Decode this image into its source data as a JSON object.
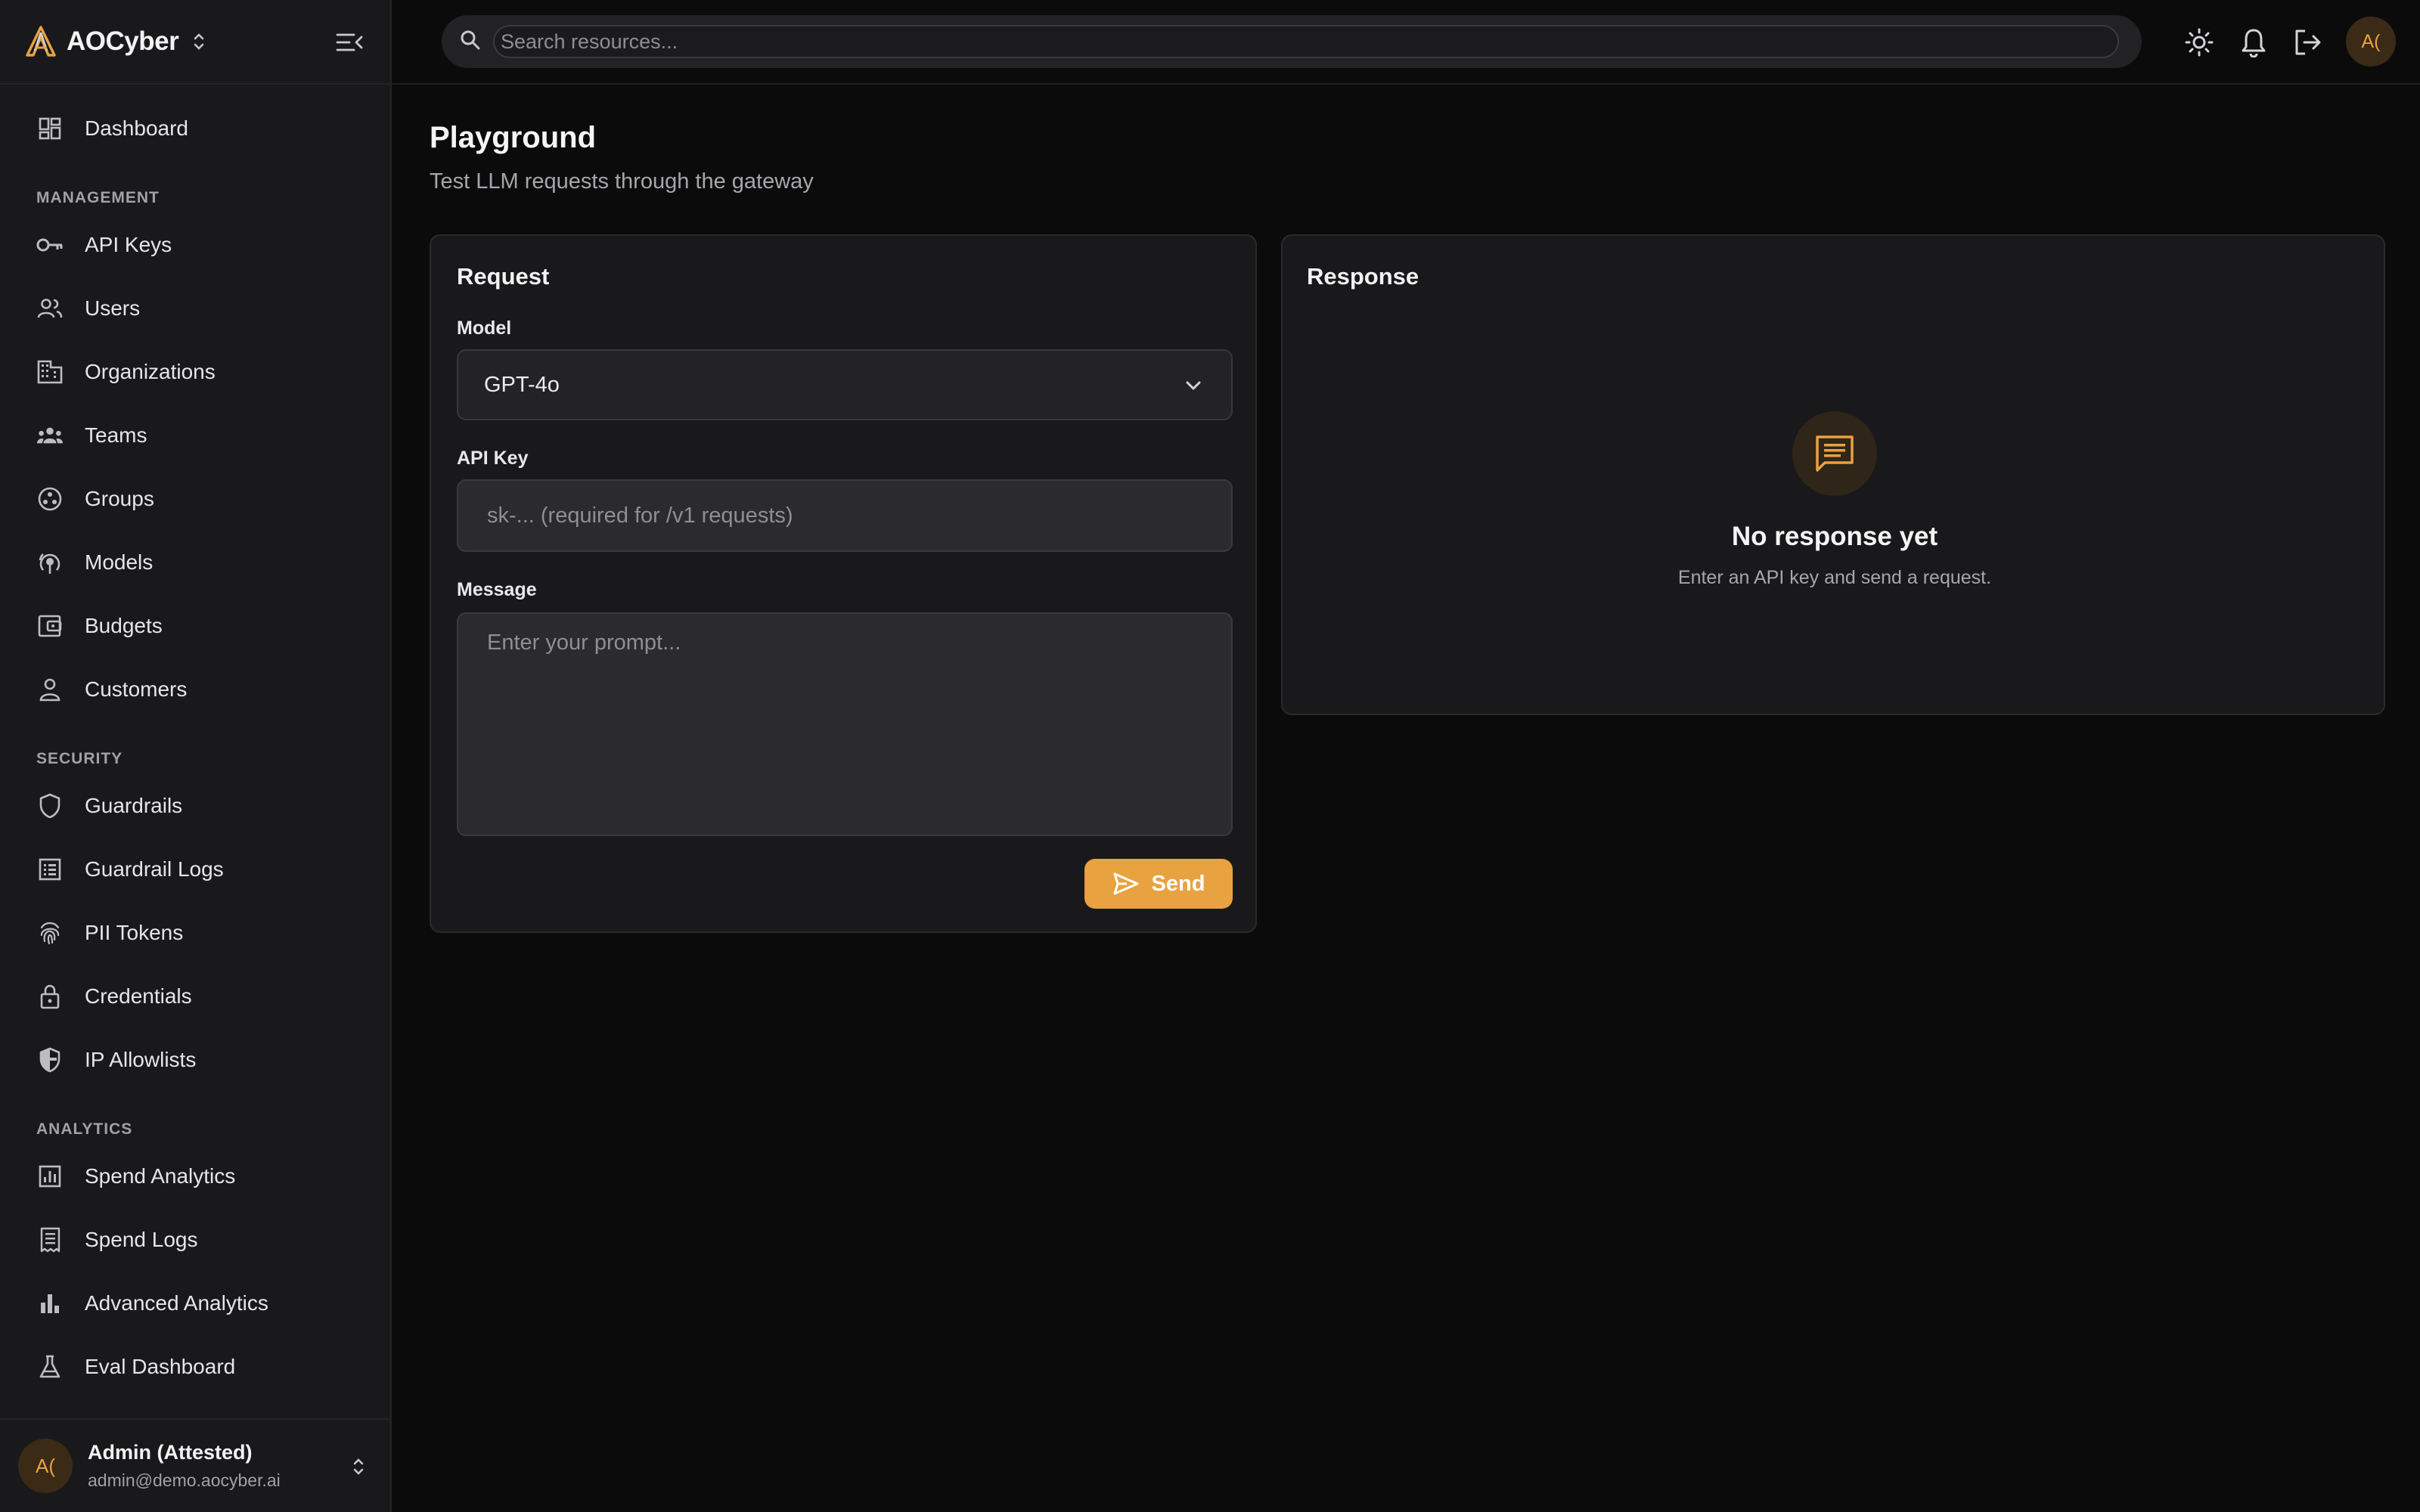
{
  "app": {
    "brand": "AOCyber"
  },
  "search": {
    "placeholder": "Search resources..."
  },
  "topbar": {
    "icons": [
      "sun-icon",
      "bell-icon",
      "logout-icon"
    ],
    "avatar_initials": "A("
  },
  "sidebar": {
    "items": [
      {
        "label": "Dashboard",
        "icon": "dashboard-icon"
      }
    ],
    "sections": [
      {
        "title": "MANAGEMENT",
        "items": [
          {
            "label": "API Keys",
            "icon": "key-icon"
          },
          {
            "label": "Users",
            "icon": "users-icon"
          },
          {
            "label": "Organizations",
            "icon": "building-icon"
          },
          {
            "label": "Teams",
            "icon": "teams-icon"
          },
          {
            "label": "Groups",
            "icon": "groups-icon"
          },
          {
            "label": "Models",
            "icon": "models-icon"
          },
          {
            "label": "Budgets",
            "icon": "wallet-icon"
          },
          {
            "label": "Customers",
            "icon": "person-icon"
          }
        ]
      },
      {
        "title": "SECURITY",
        "items": [
          {
            "label": "Guardrails",
            "icon": "shield-icon"
          },
          {
            "label": "Guardrail Logs",
            "icon": "list-icon"
          },
          {
            "label": "PII Tokens",
            "icon": "fingerprint-icon"
          },
          {
            "label": "Credentials",
            "icon": "lock-icon"
          },
          {
            "label": "IP Allowlists",
            "icon": "shield-half-icon"
          }
        ]
      },
      {
        "title": "ANALYTICS",
        "items": [
          {
            "label": "Spend Analytics",
            "icon": "analytics-icon"
          },
          {
            "label": "Spend Logs",
            "icon": "receipt-icon"
          },
          {
            "label": "Advanced Analytics",
            "icon": "bar-chart-icon"
          },
          {
            "label": "Eval Dashboard",
            "icon": "flask-icon"
          }
        ]
      }
    ]
  },
  "user": {
    "initials": "A(",
    "name": "Admin (Attested)",
    "email": "admin@demo.aocyber.ai"
  },
  "page": {
    "title": "Playground",
    "subtitle": "Test LLM requests through the gateway"
  },
  "request": {
    "title": "Request",
    "model_label": "Model",
    "model_value": "GPT-4o",
    "api_key_label": "API Key",
    "api_key_placeholder": "sk-... (required for /v1 requests)",
    "message_label": "Message",
    "message_placeholder": "Enter your prompt...",
    "send_label": "Send"
  },
  "response": {
    "title": "Response",
    "empty_title": "No response yet",
    "empty_subtitle": "Enter an API key and send a request."
  },
  "colors": {
    "accent": "#e8a240",
    "background": "#0b0b0b",
    "panel": "#19191b"
  }
}
